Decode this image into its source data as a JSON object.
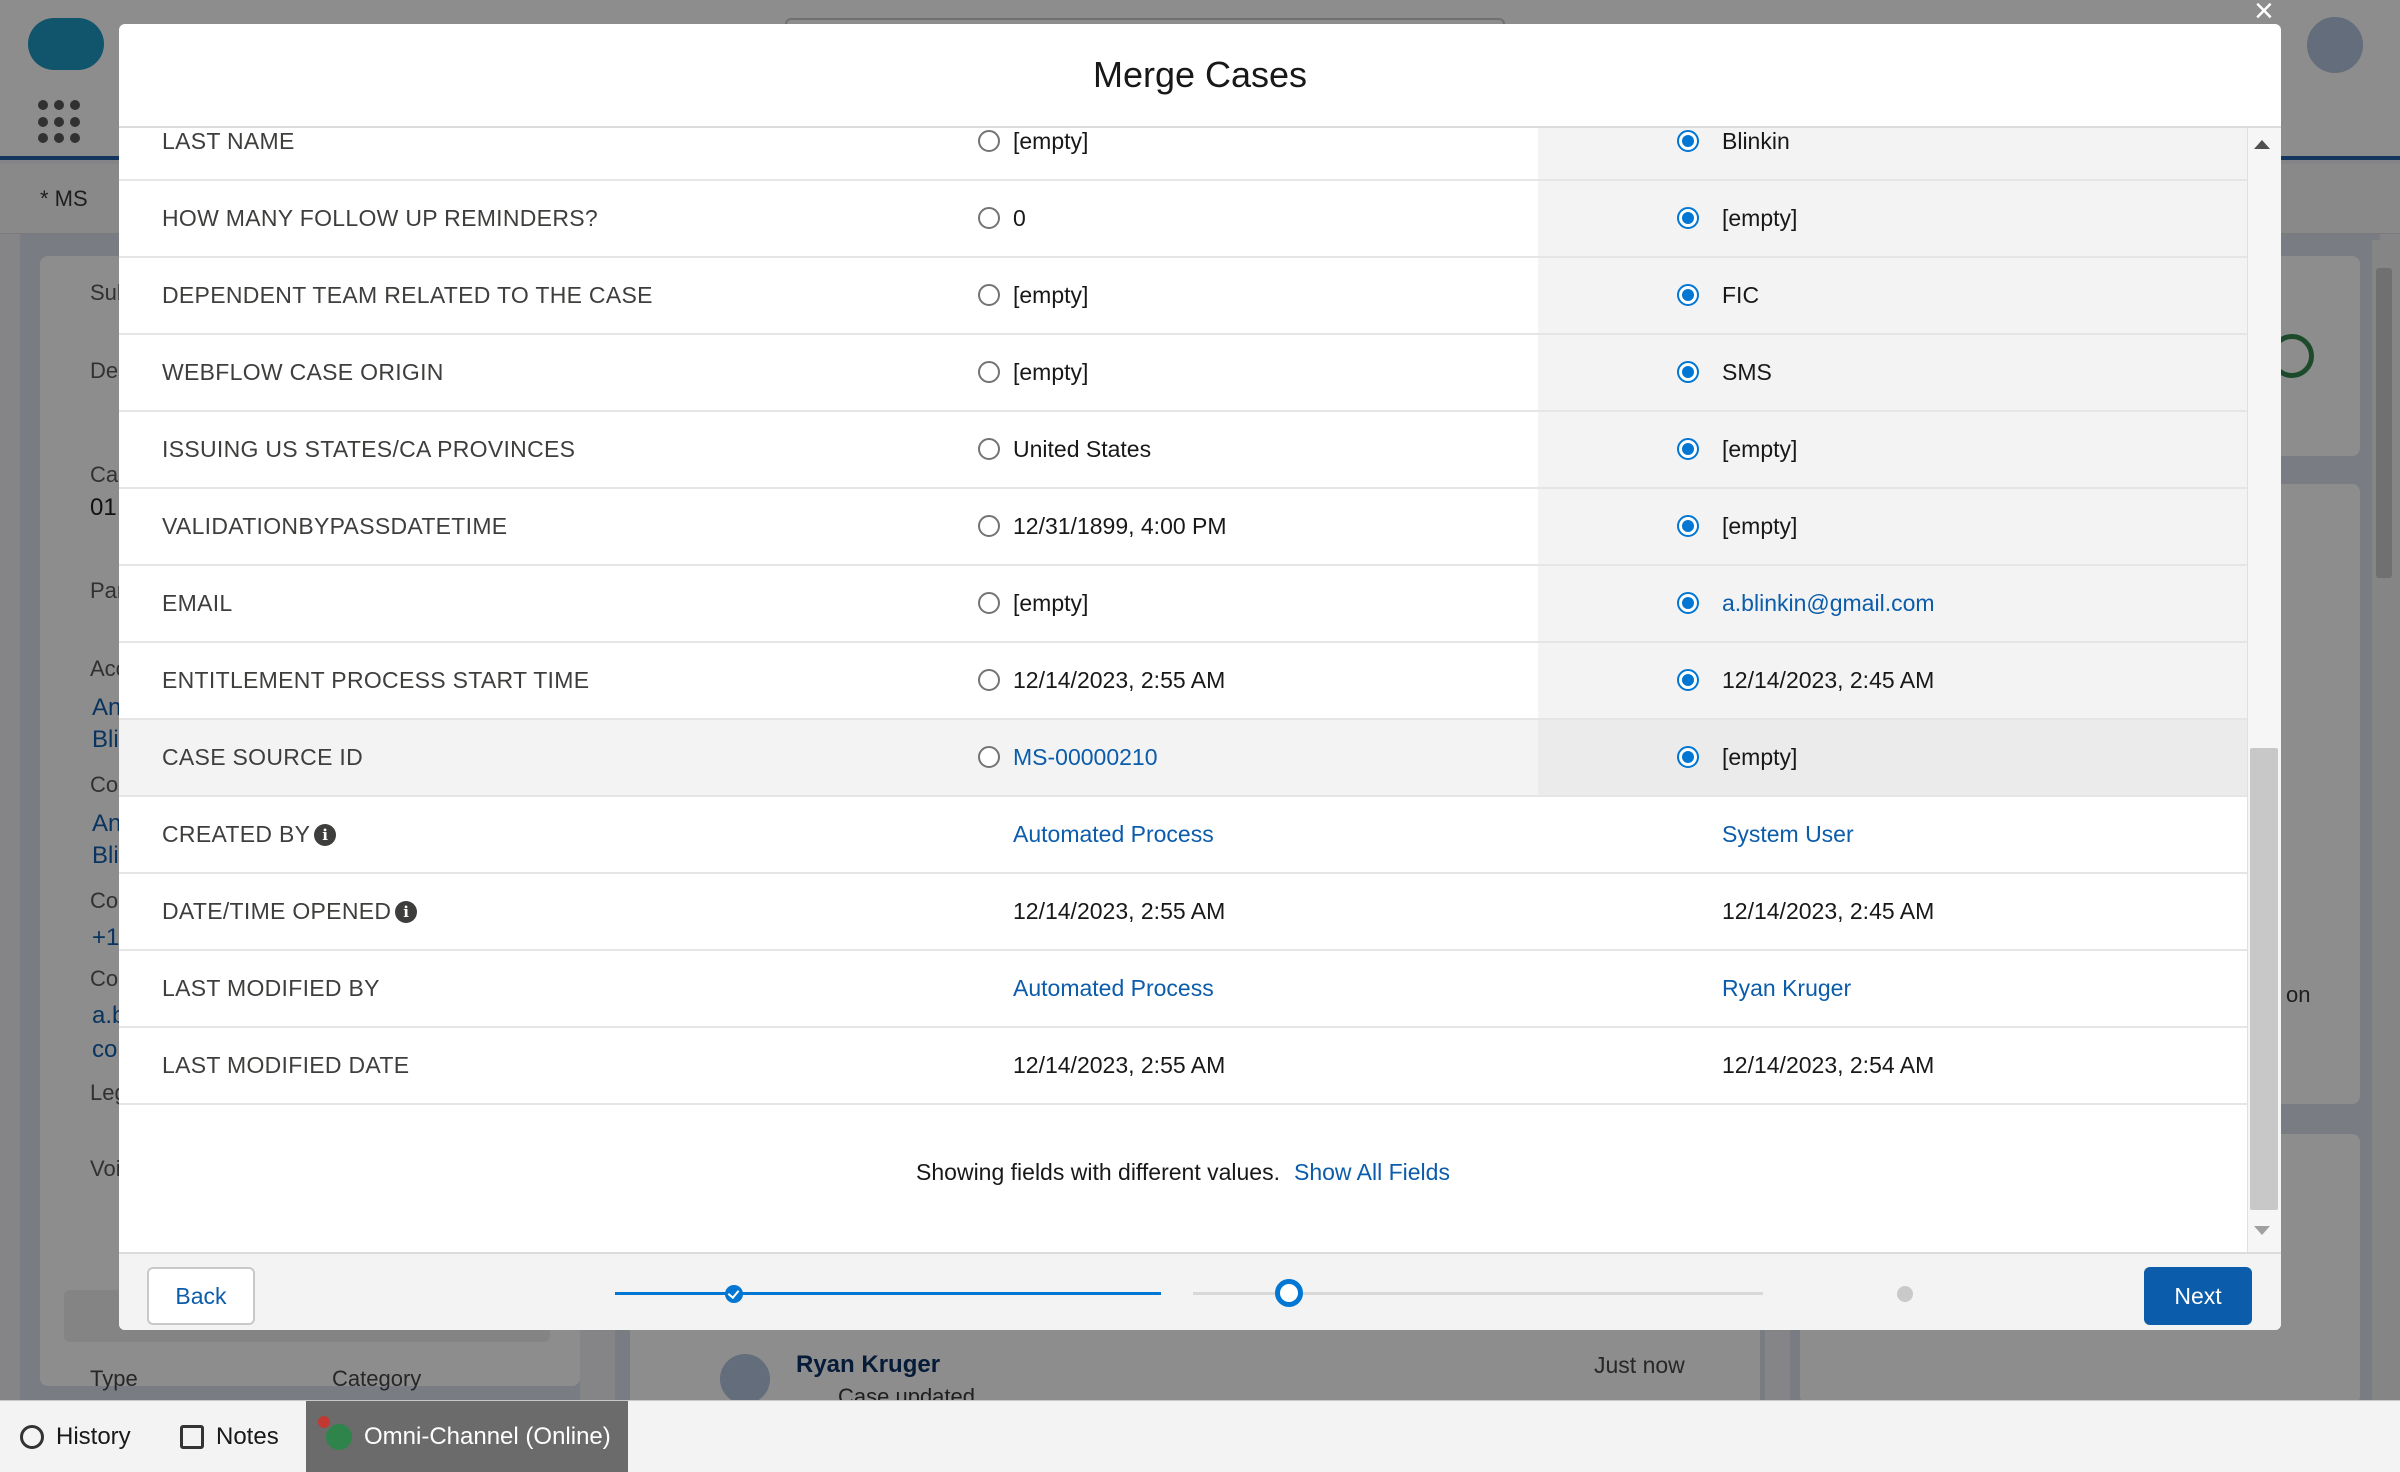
{
  "modal": {
    "title": "Merge Cases",
    "rows": [
      {
        "label": "LAST NAME",
        "a": "[empty]",
        "b": "Blinkin",
        "a_link": false,
        "b_link": false,
        "selectable": true
      },
      {
        "label": "HOW MANY FOLLOW UP REMINDERS?",
        "a": "0",
        "b": "[empty]",
        "a_link": false,
        "b_link": false,
        "selectable": true
      },
      {
        "label": "DEPENDENT TEAM RELATED TO THE CASE",
        "a": "[empty]",
        "b": "FIC",
        "a_link": false,
        "b_link": false,
        "selectable": true
      },
      {
        "label": "WEBFLOW CASE ORIGIN",
        "a": "[empty]",
        "b": "SMS",
        "a_link": false,
        "b_link": false,
        "selectable": true
      },
      {
        "label": "ISSUING US STATES/CA PROVINCES",
        "a": "United States",
        "b": "[empty]",
        "a_link": false,
        "b_link": false,
        "selectable": true
      },
      {
        "label": "VALIDATIONBYPASSDATETIME",
        "a": "12/31/1899, 4:00 PM",
        "b": "[empty]",
        "a_link": false,
        "b_link": false,
        "selectable": true
      },
      {
        "label": "EMAIL",
        "a": "[empty]",
        "b": "a.blinkin@gmail.com",
        "a_link": false,
        "b_link": true,
        "selectable": true
      },
      {
        "label": "ENTITLEMENT PROCESS START TIME",
        "a": "12/14/2023, 2:55 AM",
        "b": "12/14/2023, 2:45 AM",
        "a_link": false,
        "b_link": false,
        "selectable": true
      },
      {
        "label": "CASE SOURCE ID",
        "a": "MS-00000210",
        "b": "[empty]",
        "a_link": true,
        "b_link": false,
        "selectable": true
      },
      {
        "label": "CREATED BY",
        "a": "Automated Process",
        "b": "System User",
        "a_link": true,
        "b_link": true,
        "selectable": false,
        "info": true
      },
      {
        "label": "DATE/TIME OPENED",
        "a": "12/14/2023, 2:55 AM",
        "b": "12/14/2023, 2:45 AM",
        "a_link": false,
        "b_link": false,
        "selectable": false,
        "info": true
      },
      {
        "label": "LAST MODIFIED BY",
        "a": "Automated Process",
        "b": "Ryan Kruger",
        "a_link": true,
        "b_link": true,
        "selectable": false
      },
      {
        "label": "LAST MODIFIED DATE",
        "a": "12/14/2023, 2:55 AM",
        "b": "12/14/2023, 2:54 AM",
        "a_link": false,
        "b_link": false,
        "selectable": false
      }
    ],
    "info_glyph": "i",
    "footer_note": "Showing fields with different values.",
    "show_all_link": "Show All Fields",
    "back_label": "Back",
    "next_label": "Next",
    "progress": {
      "steps": 3,
      "current_step": 2
    },
    "close_glyph": "×"
  },
  "utility_bar": {
    "history_label": "History",
    "notes_label": "Notes",
    "omni_label": "Omni-Channel (Online)"
  },
  "background": {
    "tab_label": "* MS",
    "feed_name": "Ryan Kruger",
    "feed_sub": "Case updated",
    "feed_time": "Just now",
    "left_labels": [
      "Sub",
      "Des",
      "Cas",
      "01.",
      "Par",
      "Acc",
      "Cor",
      "Cor",
      "Cor",
      "Leg",
      "Voi"
    ],
    "left_links": [
      "An",
      "Bli",
      "An",
      "Bli",
      "+1",
      "a.b",
      "co"
    ],
    "type_label": "Type",
    "category_label": "Category",
    "right_fragment": "on",
    "colors": {
      "brand": "#0b5cab",
      "accent": "#0176d3",
      "online": "#2e844a"
    }
  }
}
